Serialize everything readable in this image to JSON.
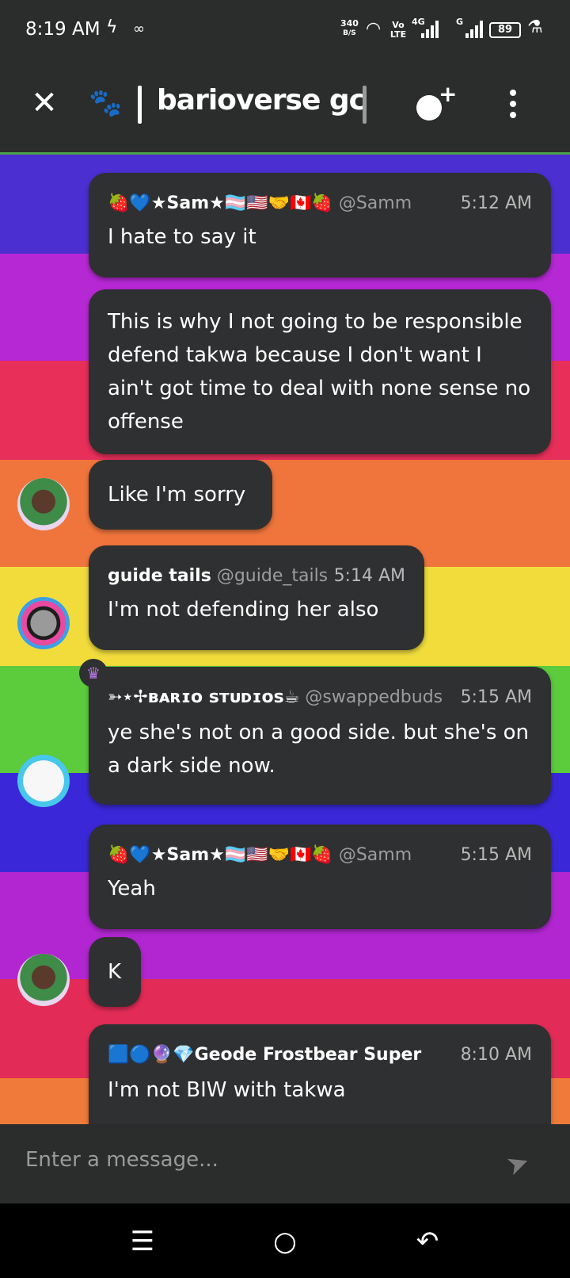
{
  "status_bar": {
    "time": "8:19 AM",
    "net_speed_value": "340",
    "net_speed_unit": "B/S",
    "volte": "Vo LTE",
    "network_4g": "4G",
    "network_g": "G",
    "battery": "89"
  },
  "header": {
    "title": "barioverse gc"
  },
  "messages": [
    {
      "author": "🍓💙★Sam★🏳️‍⚧️🇺🇸🤝🇨🇦🍓",
      "handle": "@Samm",
      "time": "5:12 AM",
      "text": "I hate to say it"
    },
    {
      "text": "This is why I not going to be responsible defend takwa because I don't want I ain't got time to deal with none sense no offense"
    },
    {
      "text": "Like I'm sorry"
    },
    {
      "author": "guide tails",
      "handle": "@guide_tails",
      "time": "5:14 AM",
      "text": "I'm not defending her also"
    },
    {
      "author": "➳⋆✢ʙᴀʀɪᴏ sᴛᴜᴅɪᴏs☕",
      "handle": "@swappedbuds",
      "time": "5:15 AM",
      "text": "ye she's not on a good side. but she's on a dark side now."
    },
    {
      "author": "🍓💙★Sam★🏳️‍⚧️🇺🇸🤝🇨🇦🍓",
      "handle": "@Samm",
      "time": "5:15 AM",
      "text": "Yeah"
    },
    {
      "text": "K"
    },
    {
      "author": "🟦🔵🔮💎Geode Frostbear Super",
      "time": "8:10 AM",
      "text": "I'm not BIW with takwa"
    }
  ],
  "composer": {
    "placeholder": "Enter a message..."
  },
  "icons": {
    "close": "close-icon",
    "paw": "paw-icon",
    "add_reaction": "add-emoji-icon",
    "menu": "more-vert-icon",
    "send": "send-icon",
    "crown": "crown-icon"
  },
  "colors": {
    "bubble": "#2f3031",
    "bar": "#2b2d2d",
    "accent_green": "#48a347",
    "crown_purple": "#b978e8"
  }
}
